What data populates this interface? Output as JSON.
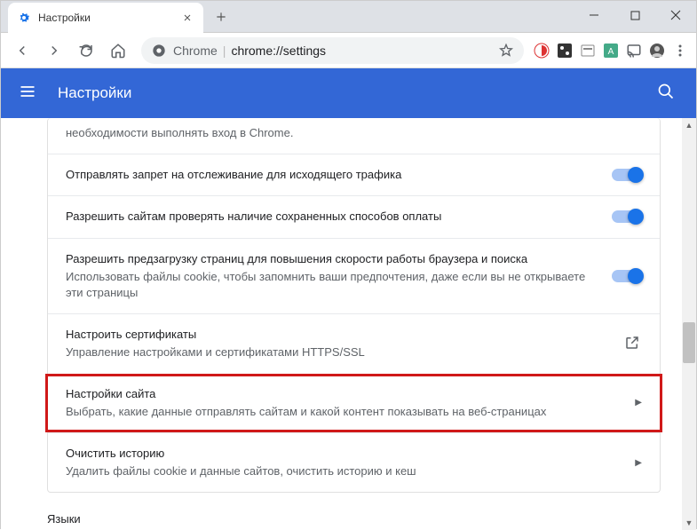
{
  "window": {
    "tab_title": "Настройки"
  },
  "addressbar": {
    "scheme_label": "Chrome",
    "url": "chrome://settings"
  },
  "header": {
    "title": "Настройки"
  },
  "rows": {
    "signin_tail": "необходимости выполнять вход в Chrome.",
    "dnt": "Отправлять запрет на отслеживание для исходящего трафика",
    "payment": "Разрешить сайтам проверять наличие сохраненных способов оплаты",
    "preload_title": "Разрешить предзагрузку страниц для повышения скорости работы браузера и поиска",
    "preload_sub": "Использовать файлы cookie, чтобы запомнить ваши предпочтения, даже если вы не открываете эти страницы",
    "certs_title": "Настроить сертификаты",
    "certs_sub": "Управление настройками и сертификатами HTTPS/SSL",
    "site_title": "Настройки сайта",
    "site_sub": "Выбрать, какие данные отправлять сайтам и какой контент показывать на веб-страницах",
    "clear_title": "Очистить историю",
    "clear_sub": "Удалить файлы cookie и данные сайтов, очистить историю и кеш"
  },
  "sections": {
    "languages": "Языки"
  }
}
